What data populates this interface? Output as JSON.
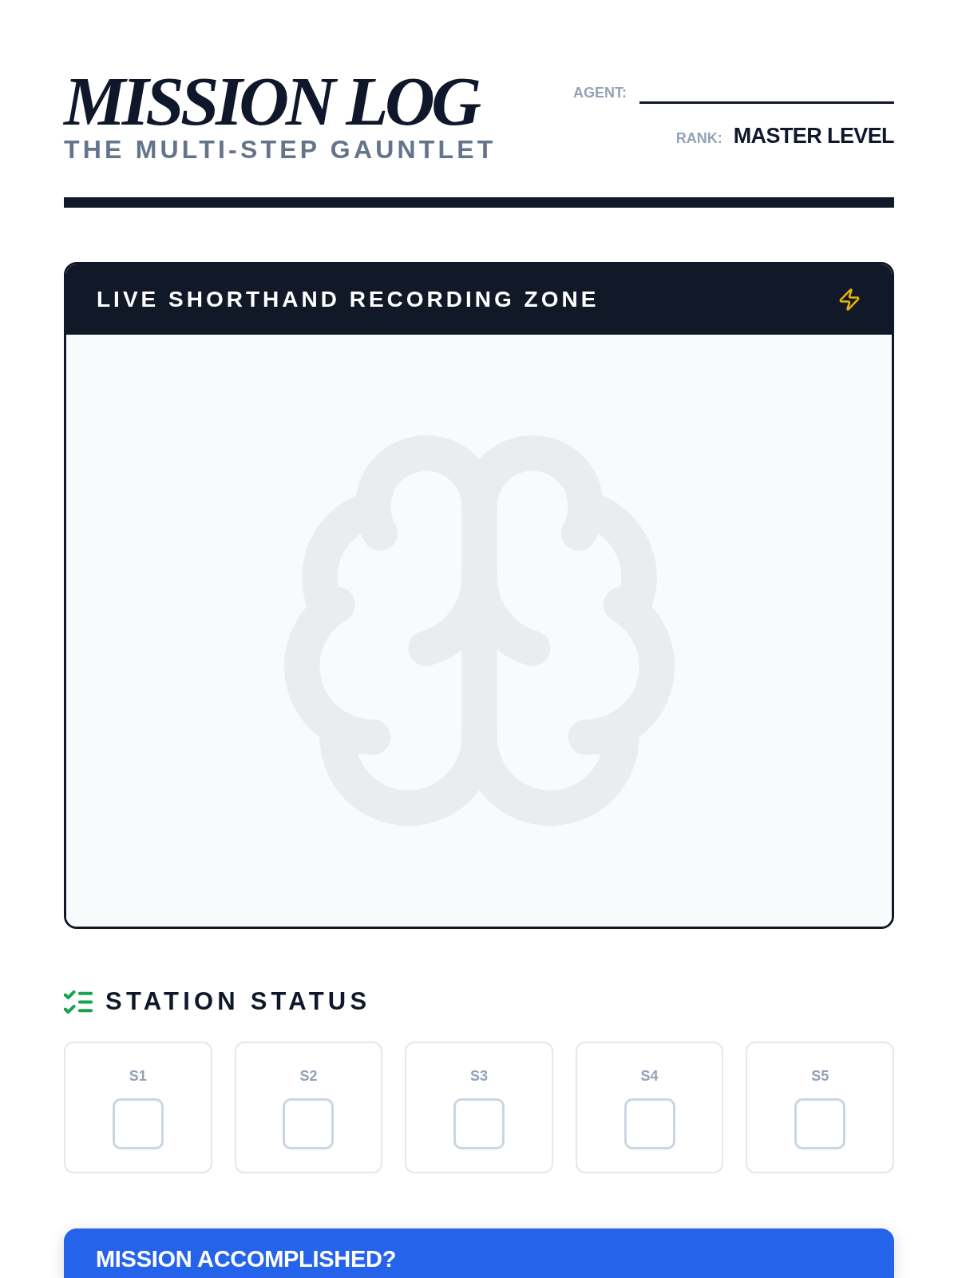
{
  "header": {
    "title": "MISSION LOG",
    "subtitle": "THE MULTI-STEP GAUNTLET",
    "agent": {
      "label": "AGENT:"
    },
    "rank": {
      "label": "RANK:",
      "value": "MASTER LEVEL"
    }
  },
  "recording_zone": {
    "title": "LIVE SHORTHAND RECORDING ZONE"
  },
  "station_status": {
    "title": "STATION STATUS",
    "stations": [
      {
        "label": "S1",
        "checked": false
      },
      {
        "label": "S2",
        "checked": false
      },
      {
        "label": "S3",
        "checked": false
      },
      {
        "label": "S4",
        "checked": false
      },
      {
        "label": "S5",
        "checked": false
      }
    ]
  },
  "completion_panel": {
    "title": "MISSION ACCOMPLISHED?"
  }
}
